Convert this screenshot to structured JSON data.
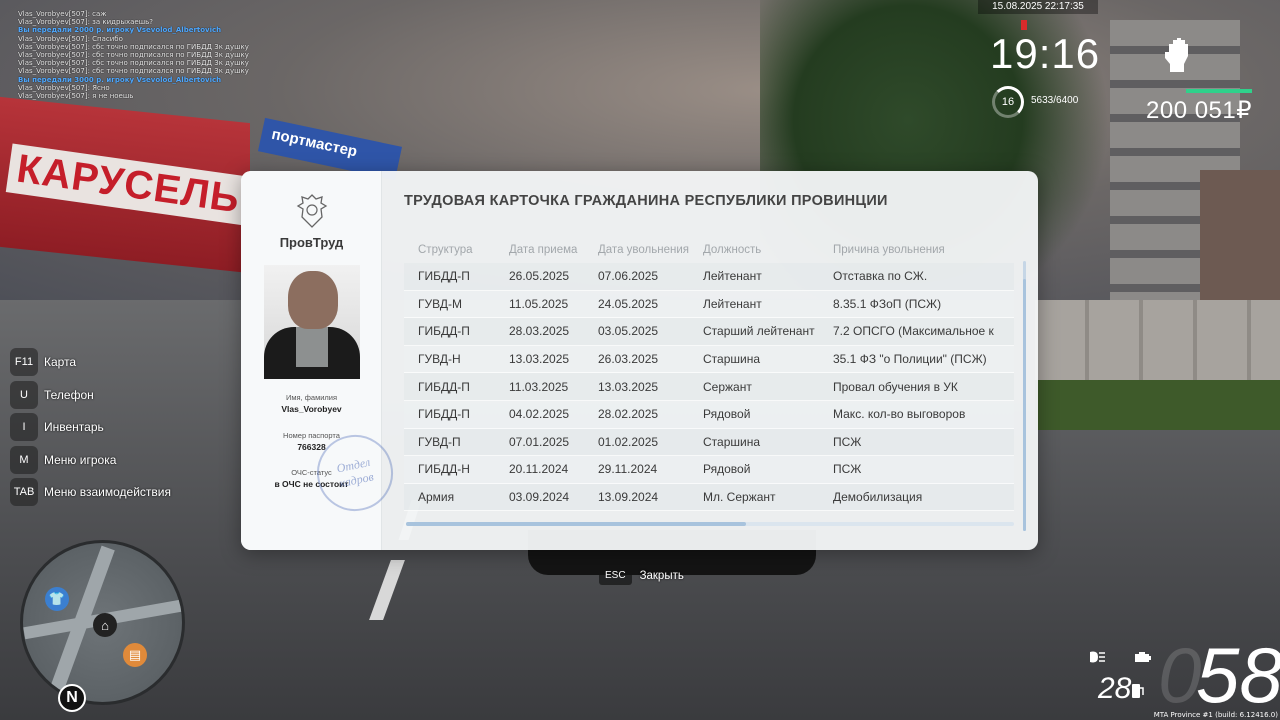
{
  "chat": [
    {
      "text": "Vlas_Vorobyev[507]: саж",
      "highlight": false
    },
    {
      "text": "Vlas_Vorobyev[507]: за кидрыхаешь?",
      "highlight": false
    },
    {
      "text": "Вы передали 2000 р. игроку Vsevolod_Albertovich",
      "highlight": true
    },
    {
      "text": "Vlas_Vorobyev[507]: Спасибо",
      "highlight": false
    },
    {
      "text": "Vlas_Vorobyev[507]: сбс точно подписался по ГИБДД 3к душку",
      "highlight": false
    },
    {
      "text": "Vlas_Vorobyev[507]: сбс точно подписался по ГИБДД 3к душку",
      "highlight": false
    },
    {
      "text": "Vlas_Vorobyev[507]: сбс точно подписался по ГИБДД 3к душку",
      "highlight": false
    },
    {
      "text": "Vlas_Vorobyev[507]: сбс точно подписался по ГИБДД 3к душку",
      "highlight": false
    },
    {
      "text": "Вы передали 3000 р. игроку Vsevolod_Albertovich",
      "highlight": true
    },
    {
      "text": "Vlas_Vorobyev[507]: Ясно",
      "highlight": false
    },
    {
      "text": "Vlas_Vorobyev[507]: я не ноешь",
      "highlight": false
    }
  ],
  "scene": {
    "mall_sign": "КАРУСЕЛЬ",
    "sport_sign": "портмастер"
  },
  "hud": {
    "datetime": "15.08.2025 22:17:35",
    "clock": "19:16",
    "level": "16",
    "xp": "5633/6400",
    "money": "200 051₽",
    "speed": "58",
    "speed_ghost": "0",
    "fuel": "28",
    "build": "MTA Province #1 (build: 6.12416.0)"
  },
  "keybinds": [
    {
      "key": "F11",
      "label": "Карта"
    },
    {
      "key": "U",
      "label": "Телефон"
    },
    {
      "key": "I",
      "label": "Инвентарь"
    },
    {
      "key": "M",
      "label": "Меню игрока"
    },
    {
      "key": "TAB",
      "label": "Меню взаимодействия"
    }
  ],
  "minimap": {
    "north": "N"
  },
  "card": {
    "org_name": "ПровТруд",
    "title": "ТРУДОВАЯ КАРТОЧКА ГРАЖДАНИНА РЕСПУБЛИКИ ПРОВИНЦИИ",
    "name_label": "Имя, фамилия",
    "name_value": "Vlas_Vorobyev",
    "passport_label": "Номер паспорта",
    "passport_value": "766328",
    "ochs_label": "ОЧС-статус",
    "ochs_value": "в ОЧС не состоит",
    "stamp_line1": "Отдел",
    "stamp_line2": "кадров",
    "columns": [
      "Структура",
      "Дата приема",
      "Дата увольнения",
      "Должность",
      "Причина увольнения"
    ],
    "rows": [
      [
        "ГИБДД-П",
        "26.05.2025",
        "07.06.2025",
        "Лейтенант",
        "Отставка по СЖ."
      ],
      [
        "ГУВД-М",
        "11.05.2025",
        "24.05.2025",
        "Лейтенант",
        "8.35.1 ФЗоП (ПСЖ)"
      ],
      [
        "ГИБДД-П",
        "28.03.2025",
        "03.05.2025",
        "Старший лейтенант",
        "7.2 ОПСГО (Максимальное к"
      ],
      [
        "ГУВД-Н",
        "13.03.2025",
        "26.03.2025",
        "Старшина",
        "35.1 ФЗ \"о Полиции\" (ПСЖ)"
      ],
      [
        "ГИБДД-П",
        "11.03.2025",
        "13.03.2025",
        "Сержант",
        "Провал обучения в УК"
      ],
      [
        "ГИБДД-П",
        "04.02.2025",
        "28.02.2025",
        "Рядовой",
        "Макс. кол-во выговоров"
      ],
      [
        "ГУВД-П",
        "07.01.2025",
        "01.02.2025",
        "Старшина",
        "ПСЖ"
      ],
      [
        "ГИБДД-Н",
        "20.11.2024",
        "29.11.2024",
        "Рядовой",
        "ПСЖ"
      ],
      [
        "Армия",
        "03.09.2024",
        "13.09.2024",
        "Мл. Сержант",
        "Демобилизация"
      ]
    ]
  },
  "close_hint": {
    "key": "ESC",
    "label": "Закрыть"
  },
  "colors": {
    "accent": "#2fd18b",
    "card_bg": "#f2f5f6",
    "scroll": "#a8c3dd",
    "alert": "#d92b2b"
  }
}
